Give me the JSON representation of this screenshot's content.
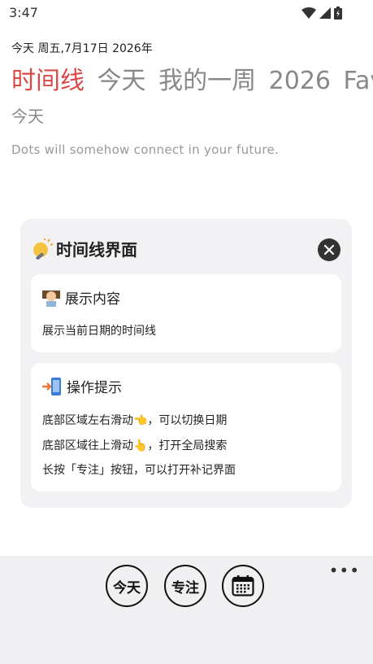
{
  "status_bar": {
    "time": "3:47"
  },
  "header": {
    "date_line": "今天  周五,7月17日 2026年",
    "tabs": [
      {
        "label": "时间线",
        "active": true
      },
      {
        "label": "今天",
        "active": false
      },
      {
        "label": "我的一周",
        "active": false
      },
      {
        "label": "2026",
        "active": false
      },
      {
        "label": "Fav",
        "active": false
      }
    ],
    "section_label": "今天",
    "quote": "Dots will somehow connect in your future."
  },
  "modal": {
    "title": "时间线界面",
    "cards": [
      {
        "heading": "展示内容",
        "lines": [
          "展示当前日期的时间线"
        ]
      },
      {
        "heading": "操作提示",
        "lines": [
          "底部区域左右滑动👈，可以切换日期",
          "底部区域往上滑动👆，打开全局搜索",
          "长按「专注」按钮，可以打开补记界面"
        ]
      }
    ]
  },
  "bottom_bar": {
    "today_label": "今天",
    "focus_label": "专注",
    "more_label": "•••"
  },
  "colors": {
    "accent": "#d94a47",
    "muted": "#888888",
    "panel": "#f2f2f4"
  },
  "icons": [
    "wifi-icon",
    "signal-icon",
    "battery-icon",
    "bulb-icon",
    "close-icon",
    "teacher-icon",
    "phone-arrow-icon",
    "calendar-icon",
    "more-icon"
  ]
}
